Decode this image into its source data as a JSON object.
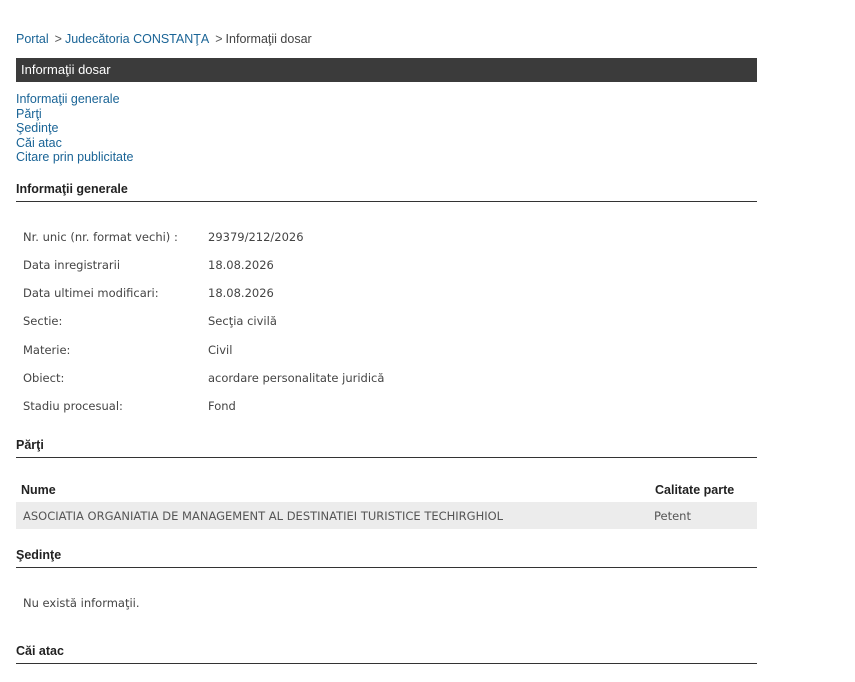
{
  "breadcrumb": {
    "portal": "Portal",
    "court": "Judecătoria CONSTANŢA",
    "current": "Informaţii dosar",
    "separator": ">"
  },
  "title": "Informaţii dosar",
  "toc": {
    "general": "Informaţii generale",
    "parti": "Părţi",
    "sedinte": "Şedinţe",
    "cai_atac": "Căi atac",
    "citare": "Citare prin publicitate"
  },
  "sections": {
    "general": "Informaţii generale",
    "parti": "Părţi",
    "sedinte": "Şedinţe",
    "cai_atac": "Căi atac"
  },
  "general_info": [
    {
      "label": "Nr. unic (nr. format vechi) :",
      "value": "29379/212/2026"
    },
    {
      "label": "Data inregistrarii",
      "value": "18.08.2026"
    },
    {
      "label": "Data ultimei modificari:",
      "value": "18.08.2026"
    },
    {
      "label": "Sectie:",
      "value": "Secţia civilă"
    },
    {
      "label": "Materie:",
      "value": "Civil"
    },
    {
      "label": "Obiect:",
      "value": "acordare personalitate juridică"
    },
    {
      "label": "Stadiu procesual:",
      "value": "Fond"
    }
  ],
  "parti_table": {
    "headers": {
      "nume": "Nume",
      "calitate": "Calitate parte"
    },
    "rows": [
      {
        "nume": "ASOCIATIA ORGANIATIA DE MANAGEMENT AL DESTINATIEI TURISTICE TECHIRGHIOL",
        "calitate": "Petent"
      }
    ]
  },
  "sedinte_message": "Nu există informaţii."
}
